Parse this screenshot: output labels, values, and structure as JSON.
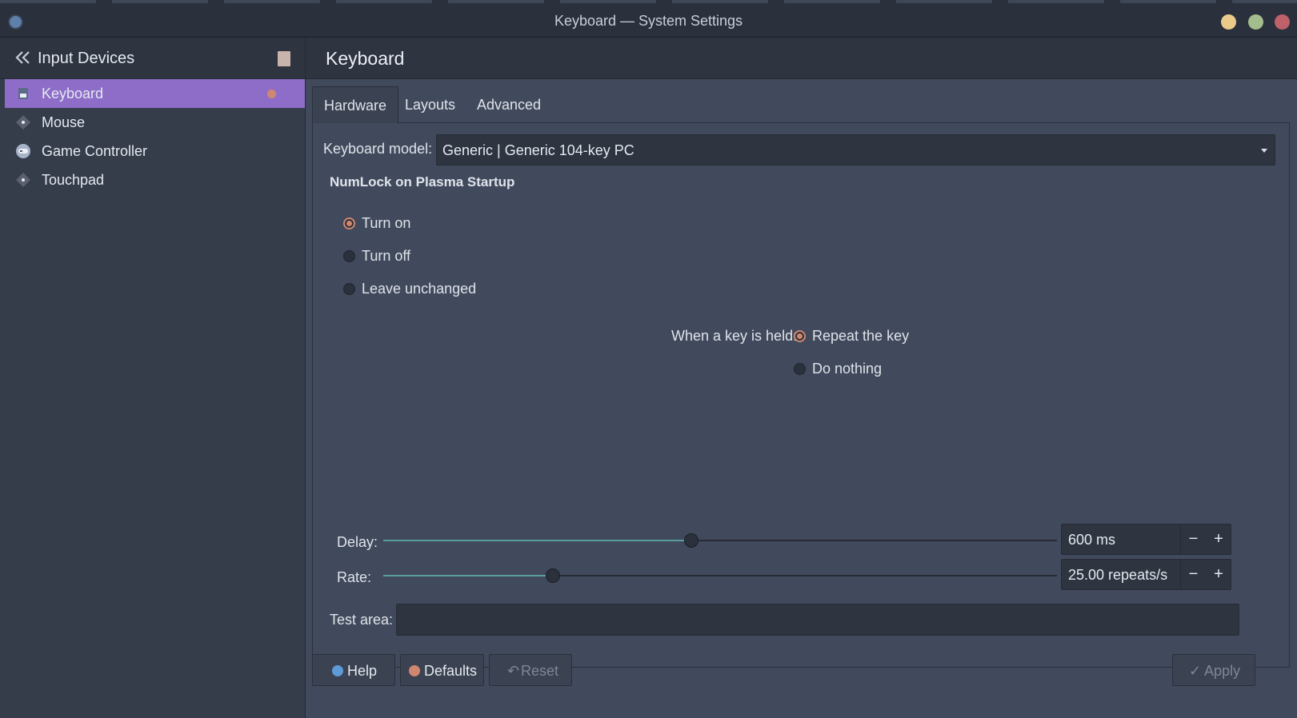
{
  "window": {
    "title": "Keyboard — System Settings"
  },
  "sidebar": {
    "title": "Input Devices",
    "items": [
      {
        "label": "Keyboard",
        "active": true,
        "icon": "keyboard-icon"
      },
      {
        "label": "Mouse",
        "active": false,
        "icon": "mouse-icon"
      },
      {
        "label": "Game Controller",
        "active": false,
        "icon": "game-controller-icon"
      },
      {
        "label": "Touchpad",
        "active": false,
        "icon": "touchpad-icon"
      }
    ]
  },
  "main": {
    "title": "Keyboard",
    "tabs": [
      {
        "label": "Hardware",
        "active": true
      },
      {
        "label": "Layouts",
        "active": false
      },
      {
        "label": "Advanced",
        "active": false
      }
    ],
    "hardware": {
      "keyboard_model_label": "Keyboard model:",
      "keyboard_model_value": "Generic | Generic 104-key PC",
      "numlock_heading": "NumLock on Plasma Startup",
      "numlock_options": [
        {
          "label": "Turn on",
          "checked": true
        },
        {
          "label": "Turn off",
          "checked": false
        },
        {
          "label": "Leave unchanged",
          "checked": false
        }
      ],
      "key_held_label": "When a key is held:",
      "key_held_options": [
        {
          "label": "Repeat the key",
          "checked": true
        },
        {
          "label": "Do nothing",
          "checked": false
        }
      ],
      "delay": {
        "label": "Delay:",
        "value_text": "600 ms",
        "fraction": 0.457
      },
      "rate": {
        "label": "Rate:",
        "value_text": "25.00 repeats/s",
        "fraction": 0.252
      },
      "test_area_label": "Test area:",
      "test_area_value": ""
    }
  },
  "footer": {
    "help": "Help",
    "defaults": "Defaults",
    "reset": "Reset",
    "apply": "Apply"
  },
  "colors": {
    "accent": "#8e6dc8",
    "radio_checked": "#d08770",
    "slider_fill": "#5a9e99"
  }
}
